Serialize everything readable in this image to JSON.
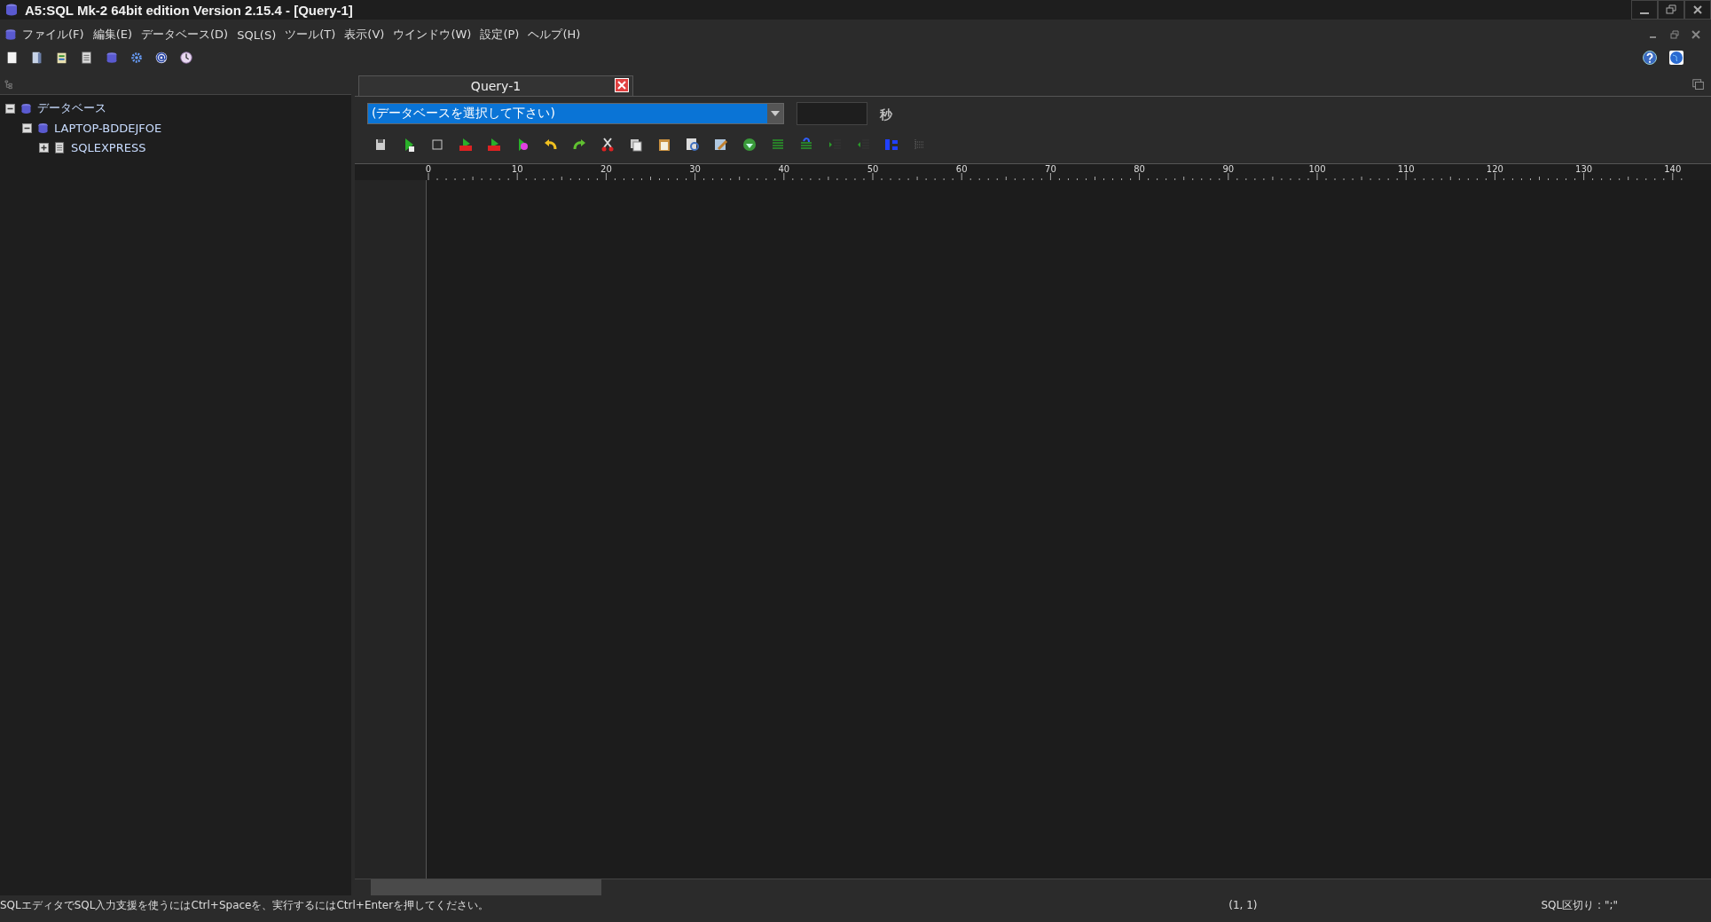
{
  "window": {
    "title": "A5:SQL Mk-2 64bit edition Version 2.15.4 - [Query-1]"
  },
  "menu": [
    "ファイル(F)",
    "編集(E)",
    "データベース(D)",
    "SQL(S)",
    "ツール(T)",
    "表示(V)",
    "ウインドウ(W)",
    "設定(P)",
    "ヘルプ(H)"
  ],
  "tree": [
    {
      "label": "データベース",
      "expanded": true,
      "children": [
        {
          "label": "LAPTOP-BDDEJFOE",
          "expanded": true,
          "children": [
            {
              "label": "SQLEXPRESS",
              "expanded": false
            }
          ]
        }
      ]
    }
  ],
  "tabs": [
    {
      "label": "Query-1",
      "selected": true
    }
  ],
  "database_select": {
    "value": "(データベースを選択して下さい)"
  },
  "timeout": {
    "unit": "秒"
  },
  "ruler": [
    "0",
    "10",
    "20",
    "30",
    "40",
    "50",
    "60",
    "70",
    "80",
    "90",
    "100",
    "110",
    "120",
    "130",
    "140"
  ],
  "status_bar": {
    "message": "SQLエディタでSQL入力支援を使うにはCtrl+Spaceを、実行するにはCtrl+Enterを押してください。",
    "position": "(1, 1)",
    "delimiter": "SQL区切り : \";\""
  }
}
